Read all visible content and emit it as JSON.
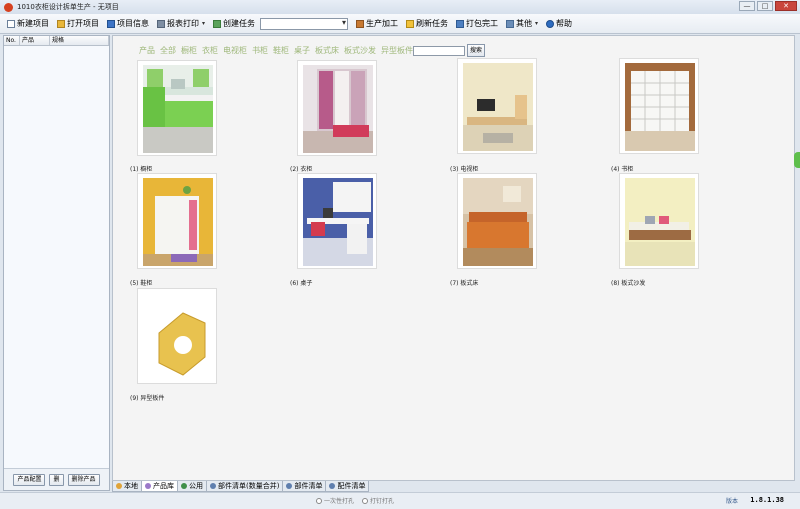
{
  "window": {
    "title": "1010衣柜设计拆单生产 - 无项目",
    "min_label": "—",
    "max_label": "□",
    "close_label": "✕"
  },
  "toolbar": {
    "new_project": "新建项目",
    "open_project": "打开项目",
    "project_info": "项目信息",
    "report_print": "报表打印",
    "create_task": "创建任务",
    "task_select_value": "",
    "production": "生产加工",
    "refresh_task": "刷新任务",
    "pack_done": "打包完工",
    "other": "其他",
    "help": "帮助",
    "caret": "▾"
  },
  "sidebar": {
    "columns": [
      "No.",
      "产品",
      "规格"
    ],
    "buttons": [
      "产品配置",
      "删",
      "删除产品"
    ]
  },
  "categories": {
    "label": "产品",
    "items": [
      "全部",
      "橱柜",
      "衣柜",
      "电视柜",
      "书柜",
      "鞋柜",
      "桌子",
      "板式床",
      "板式沙发",
      "异型板件"
    ]
  },
  "search": {
    "value": "",
    "button": "搜索"
  },
  "products": [
    {
      "caption": "(1) 橱柜"
    },
    {
      "caption": "(2) 衣柜"
    },
    {
      "caption": "(3) 电视柜"
    },
    {
      "caption": "(4) 书柜"
    },
    {
      "caption": "(5) 鞋柜"
    },
    {
      "caption": "(6) 桌子"
    },
    {
      "caption": "(7) 板式床"
    },
    {
      "caption": "(8) 板式沙发"
    },
    {
      "caption": "(9) 异型板件"
    }
  ],
  "tabs": [
    "本地",
    "产品库",
    "公用",
    "部件清单(数量合并)",
    "部件清单",
    "配件清单"
  ],
  "status": {
    "radio1": "一次性打孔",
    "radio2": "打钉打孔",
    "version_label": "版本",
    "version": "1.8.1.38"
  }
}
